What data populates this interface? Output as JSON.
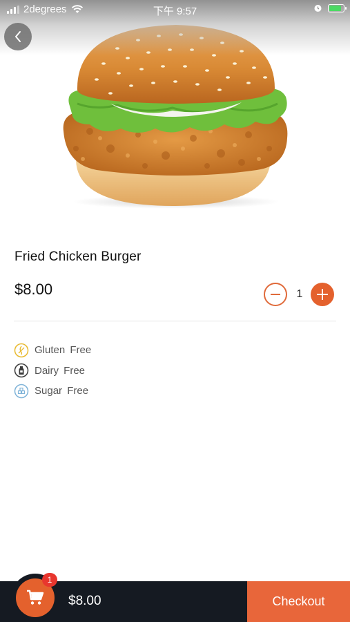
{
  "status_bar": {
    "carrier": "2degrees",
    "time": "下午 9:57",
    "battery_level": 0.85
  },
  "hero": {
    "image": "fried-chicken-burger-photo",
    "back_icon": "chevron-left-icon"
  },
  "product": {
    "name": "Fried Chicken Burger",
    "price": "$8.00",
    "quantity": "1"
  },
  "dietary": [
    {
      "icon": "gluten-free-icon",
      "label": "Gluten Free"
    },
    {
      "icon": "dairy-free-icon",
      "label": "Dairy Free"
    },
    {
      "icon": "sugar-free-icon",
      "label": "Sugar Free"
    }
  ],
  "cart": {
    "badge_count": "1",
    "total": "$8.00",
    "checkout_label": "Checkout"
  },
  "colors": {
    "accent": "#e4612d",
    "checkout": "#e8663a",
    "bar": "#151a22",
    "badge": "#e8362e"
  }
}
